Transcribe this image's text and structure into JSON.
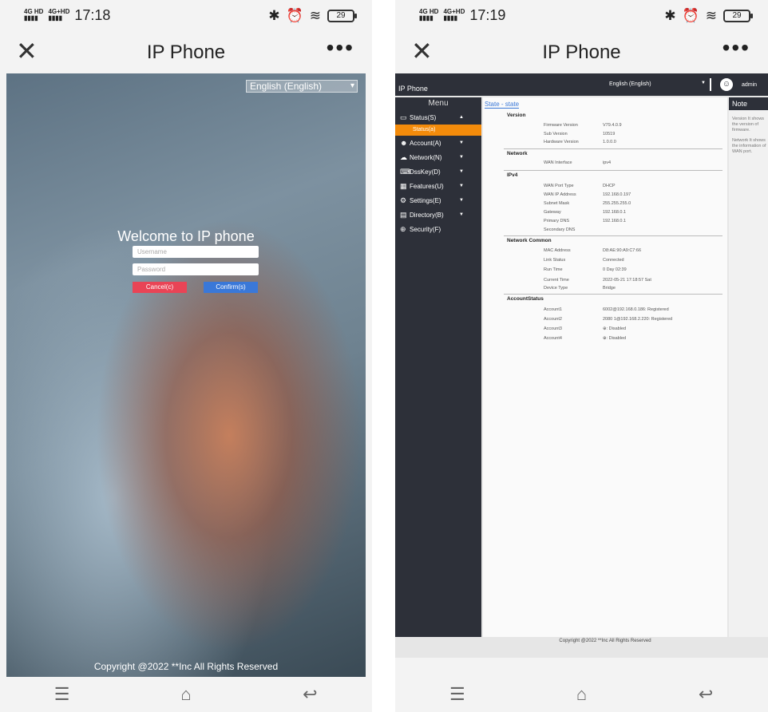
{
  "left": {
    "status": {
      "network": [
        "4G HD",
        "4G+HD"
      ],
      "time": "17:18",
      "battery": "29"
    },
    "title_bar": {
      "title": "IP Phone"
    },
    "login": {
      "language": "English (English)",
      "welcome": "Welcome to IP phone",
      "username_placeholder": "Username",
      "password_placeholder": "Password",
      "cancel_label": "Cancel(c)",
      "confirm_label": "Confirm(s)",
      "copyright": "Copyright @2022 **Inc All Rights Reserved"
    }
  },
  "right": {
    "status": {
      "network": [
        "4G HD",
        "4G+HD"
      ],
      "time": "17:19",
      "battery": "29"
    },
    "title_bar": {
      "title": "IP Phone"
    },
    "header": {
      "app_name": "IP Phone",
      "language": "English (English)",
      "user": "admin"
    },
    "menu": {
      "heading": "Menu",
      "items": [
        {
          "label": "Status(S)",
          "icon": "monitor-icon"
        },
        {
          "label": "Account(A)",
          "icon": "user-icon"
        },
        {
          "label": "Network(N)",
          "icon": "network-icon"
        },
        {
          "label": "DssKey(D)",
          "icon": "keyboard-icon"
        },
        {
          "label": "Features(U)",
          "icon": "grid-icon"
        },
        {
          "label": "Settings(E)",
          "icon": "gear-icon"
        },
        {
          "label": "Directory(B)",
          "icon": "book-icon"
        },
        {
          "label": "Security(F)",
          "icon": "shield-icon"
        }
      ],
      "sub_active": "Status(a)"
    },
    "breadcrumb": "State - state",
    "sections": {
      "version": {
        "title": "Version",
        "rows": [
          {
            "k": "Firmware Version",
            "v": "V79.4.0.9"
          },
          {
            "k": "Sub Version",
            "v": "10519"
          },
          {
            "k": "Hardware Version",
            "v": "1.0.0.0"
          }
        ]
      },
      "network": {
        "title": "Network",
        "rows": [
          {
            "k": "WAN Interface",
            "v": "ipv4"
          }
        ]
      },
      "ipv4": {
        "title": "IPv4",
        "rows": [
          {
            "k": "WAN Port Type",
            "v": "DHCP"
          },
          {
            "k": "WAN IP Address",
            "v": "192.168.0.197"
          },
          {
            "k": "Subnet Mask",
            "v": "255.255.255.0"
          },
          {
            "k": "Gateway",
            "v": "192.168.0.1"
          },
          {
            "k": "Primary DNS",
            "v": "192.168.0.1"
          },
          {
            "k": "Secondary DNS",
            "v": ""
          }
        ]
      },
      "network_common": {
        "title": "Network Common",
        "rows": [
          {
            "k": "MAC Address",
            "v": "D8:AE:90:A9:C7:66"
          },
          {
            "k": "Link Status",
            "v": "Connected"
          },
          {
            "k": "Run Time",
            "v": "0 Day 02:39"
          },
          {
            "k": "Current Time",
            "v": "2022-05-21 17:18:57 Sat"
          },
          {
            "k": "Device Type",
            "v": "Bridge"
          }
        ]
      },
      "account_status": {
        "title": "AccountStatus",
        "rows": [
          {
            "k": "Account1",
            "v": "6002@192.168.0.186: Registered"
          },
          {
            "k": "Account2",
            "v": "2080 1@192.168.2.220: Registered"
          },
          {
            "k": "Account3",
            "v": "⊕: Disabled"
          },
          {
            "k": "Account4",
            "v": "⊕: Disabled"
          }
        ]
      }
    },
    "note": {
      "heading": "Note",
      "version_note": "Version It shows the version of firmware.",
      "network_note": "Network It shows the information of WAN port."
    },
    "copyright": "Copyright @2022 **Inc All Rights Reserved"
  }
}
